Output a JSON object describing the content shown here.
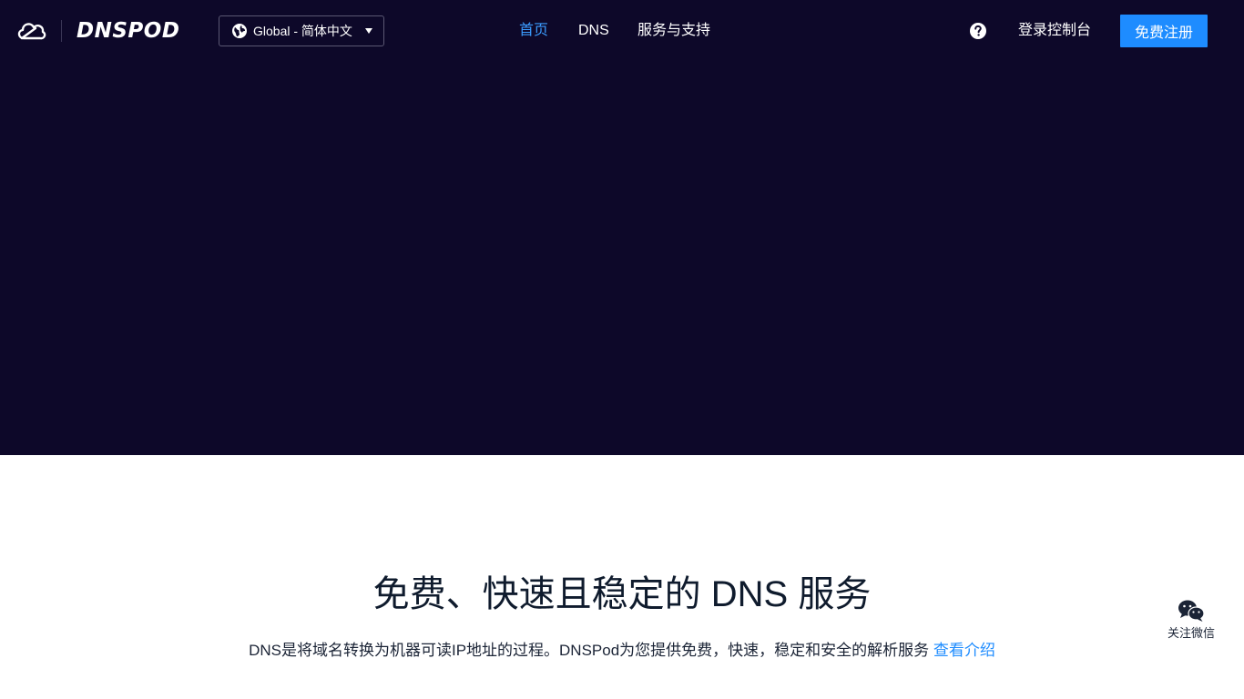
{
  "brand": {
    "name": "DNSPOD",
    "logo_icon": "cloud-logo-icon"
  },
  "header": {
    "language_selector": {
      "icon": "globe-icon",
      "value": "Global - 简体中文"
    },
    "nav": [
      {
        "label": "首页",
        "active": true
      },
      {
        "label": "DNS",
        "active": false
      },
      {
        "label": "服务与支持",
        "active": false
      }
    ],
    "help_icon": "question-circle-icon",
    "login_label": "登录控制台",
    "register_label": "免费注册"
  },
  "hero": {
    "background_color": "#0d0829"
  },
  "intro": {
    "title": "免费、快速且稳定的 DNS 服务",
    "description": "DNS是将域名转换为机器可读IP地址的过程。DNSPod为您提供免费，快速，稳定和安全的解析服务",
    "link_label": "查看介绍"
  },
  "float_widget": {
    "icon": "wechat-icon",
    "label": "关注微信"
  },
  "colors": {
    "accent": "#1e8cff",
    "active_nav": "#3b9cff",
    "dark_bg": "#0d0829"
  }
}
